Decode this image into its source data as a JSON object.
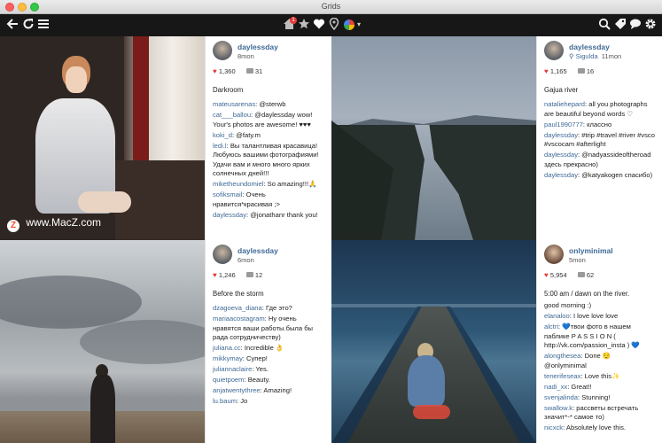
{
  "window": {
    "title": "Grids"
  },
  "toolbar": {
    "left_icons": [
      "back-arrow-icon",
      "refresh-icon",
      "menu-icon"
    ],
    "center_icons": [
      "home-icon",
      "star-icon",
      "heart-icon",
      "location-pin-icon",
      "avatar-dropdown"
    ],
    "home_badge": "1",
    "right_icons": [
      "search-icon",
      "tag-icon",
      "chat-bubble-icon",
      "gear-icon"
    ]
  },
  "watermark": {
    "badge": "Z",
    "text": "www.MacZ.com"
  },
  "posts": [
    {
      "username": "daylessday",
      "time": "8mon",
      "location": "",
      "likes": "1,360",
      "comments": "31",
      "caption": "Darkroom",
      "comment_list": [
        {
          "who": "mateusarenas",
          "text": ": @sterwb"
        },
        {
          "who": "cat___ballou",
          "text": ": @daylessday wow! Your's photos are awesome! ♥♥♥"
        },
        {
          "who": "koki_d",
          "text": ": @faty.m"
        },
        {
          "who": "ledi.l",
          "text": ": Вы талантливая красавица! Любуюсь вашими фотографиями! Удачи вам и много много ярких солнечных дней!!!"
        },
        {
          "who": "miketheundomiel",
          "text": ": So amazing!!!🙏"
        },
        {
          "who": "sofiksmail",
          "text": ": Очень нравится*красивая ;>"
        },
        {
          "who": "daylessday",
          "text": ": @jonathanr thank you!"
        }
      ]
    },
    {
      "username": "daylessday",
      "time": "11mon",
      "location": "Sigulda",
      "likes": "1,165",
      "comments": "16",
      "caption": "Gajua river",
      "comment_list": [
        {
          "who": "nataliehepard",
          "text": ": all you photographs are beautiful beyond words ♡"
        },
        {
          "who": "paul1990777",
          "text": ": классно"
        },
        {
          "who": "daylessday",
          "text": ": #trip #travel #river #vsco #vscocam #afterlight"
        },
        {
          "who": "daylessday",
          "text": ": @nadyassideoftheroad здесь прекрасно)"
        },
        {
          "who": "daylessday",
          "text": ": @katyakogen спасибо)"
        }
      ]
    },
    {
      "username": "daylessday",
      "time": "6mon",
      "location": "",
      "likes": "1,246",
      "comments": "12",
      "caption": "Before the storm",
      "comment_list": [
        {
          "who": "dzagoeva_diana",
          "text": ": Где это?"
        },
        {
          "who": "mariaacostagram",
          "text": ": Ну очень нравятся ваши работы.была бы рада сотрудничеству)"
        },
        {
          "who": "juliana.cc",
          "text": ": Incredible 👌"
        },
        {
          "who": "mikkymay",
          "text": ": Супер!"
        },
        {
          "who": "juliannaclaire",
          "text": ": Yes."
        },
        {
          "who": "quietpoem",
          "text": ": Beauty."
        },
        {
          "who": "anjatwentythree",
          "text": ": Amazing!"
        },
        {
          "who": "lu.baum",
          "text": ": Jo"
        }
      ]
    },
    {
      "username": "onlyminimal",
      "time": "5mon",
      "location": "",
      "likes": "5,954",
      "comments": "62",
      "caption": "5:00 am / dawn on the river.",
      "comment_list": [
        {
          "who": "",
          "text": "good morning :)"
        },
        {
          "who": "elanaloo",
          "text": ": I love love love"
        },
        {
          "who": "alctri",
          "text": ": 💙твои фото в нашем паблике P A S S I O N ( http://vk.com/passion_insta ) 💙"
        },
        {
          "who": "alongthesea",
          "text": ": Done 😌 @onlyminimal"
        },
        {
          "who": "tenerifeseax",
          "text": ": Love this✨"
        },
        {
          "who": "nadi_xx",
          "text": ": Great!!"
        },
        {
          "who": "svenjalinda",
          "text": ": Stunning!"
        },
        {
          "who": "swallow.k",
          "text": ": рассветы встречать значит*-* самое то)"
        },
        {
          "who": "nicxck",
          "text": ": Absolutely love this."
        }
      ]
    }
  ],
  "colors": {
    "link": "#3f6a96",
    "heart": "#e53935",
    "toolbar": "#171717"
  }
}
